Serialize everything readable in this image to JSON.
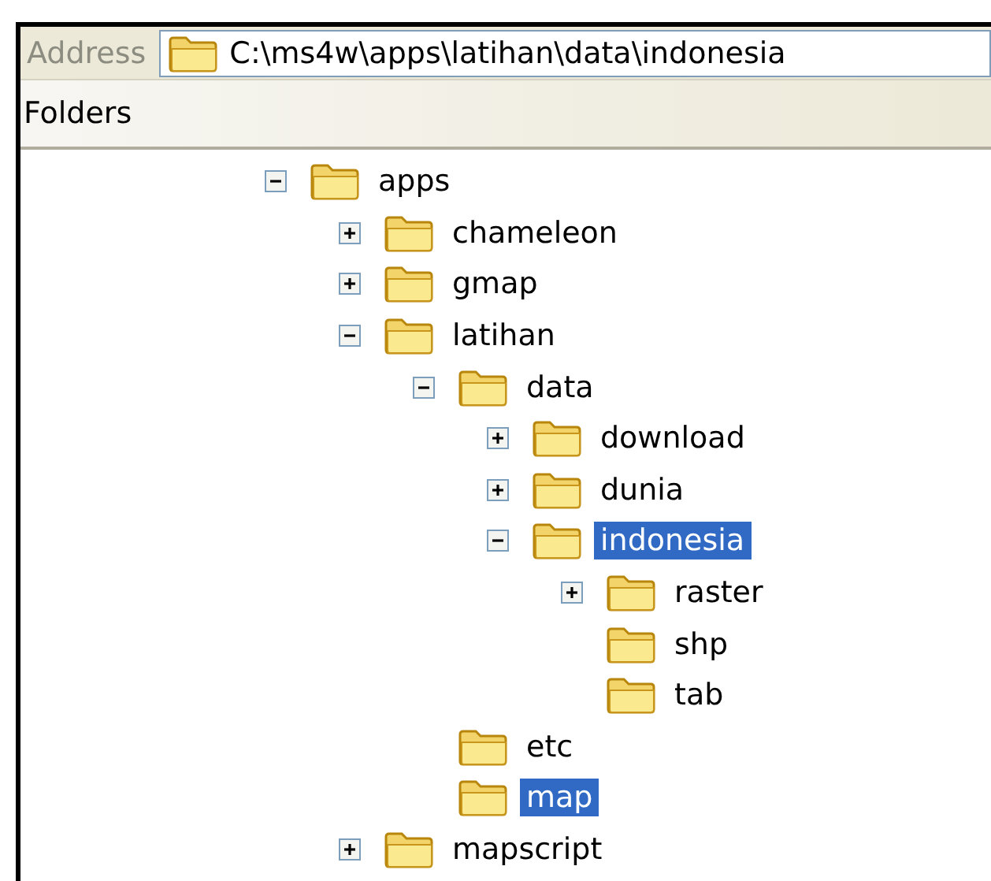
{
  "address_bar": {
    "label": "Address",
    "value": "C:\\ms4w\\apps\\latihan\\data\\indonesia"
  },
  "folders_pane": {
    "title": "Folders"
  },
  "tree": [
    {
      "label": "apps",
      "expanded": true,
      "selected": false,
      "children": [
        {
          "label": "chameleon",
          "expanded": false,
          "selected": false
        },
        {
          "label": "gmap",
          "expanded": false,
          "selected": false
        },
        {
          "label": "latihan",
          "expanded": true,
          "selected": false,
          "children": [
            {
              "label": "data",
              "expanded": true,
              "selected": false,
              "children": [
                {
                  "label": "download",
                  "expanded": false,
                  "selected": false
                },
                {
                  "label": "dunia",
                  "expanded": false,
                  "selected": false
                },
                {
                  "label": "indonesia",
                  "expanded": true,
                  "selected": true,
                  "children": [
                    {
                      "label": "raster",
                      "expanded": false,
                      "selected": false
                    },
                    {
                      "label": "shp",
                      "selected": false
                    },
                    {
                      "label": "tab",
                      "selected": false
                    }
                  ]
                }
              ]
            },
            {
              "label": "etc",
              "selected": false
            },
            {
              "label": "map",
              "selected": true
            }
          ]
        },
        {
          "label": "mapscript",
          "expanded": false,
          "selected": false
        }
      ]
    }
  ]
}
